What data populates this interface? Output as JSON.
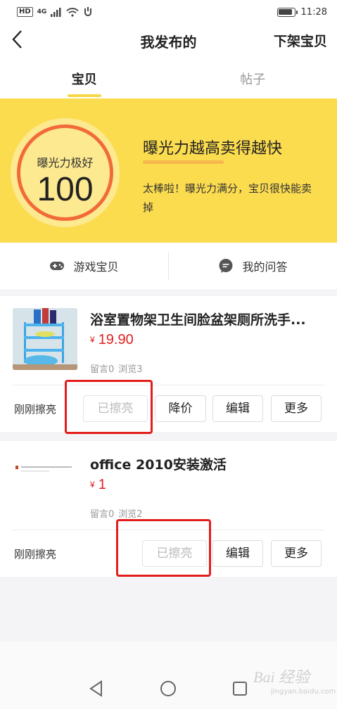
{
  "status_bar": {
    "hd": "HD",
    "network": "4G",
    "time": "11:28"
  },
  "header": {
    "title": "我发布的",
    "action": "下架宝贝"
  },
  "tabs": [
    {
      "label": "宝贝",
      "active": true
    },
    {
      "label": "帖子",
      "active": false
    }
  ],
  "banner": {
    "score_label": "曝光力极好",
    "score_value": "100",
    "headline": "曝光力越高卖得越快",
    "desc": "太棒啦！曝光力满分，宝贝很快能卖掉"
  },
  "quick_links": [
    {
      "label": "游戏宝贝",
      "icon": "gamepad-icon"
    },
    {
      "label": "我的问答",
      "icon": "chat-bubble-icon"
    }
  ],
  "listings": [
    {
      "title": "浴室置物架卫生间脸盆架厕所洗手...",
      "currency": "¥",
      "price": "19.90",
      "comments": "留言0",
      "views": "浏览3",
      "bump_status": "刚刚擦亮",
      "buttons": {
        "bumped": "已擦亮",
        "reduce": "降价",
        "edit": "编辑",
        "more": "更多"
      }
    },
    {
      "title": "office 2010安装激活",
      "currency": "¥",
      "price": "1",
      "comments": "留言0",
      "views": "浏览2",
      "bump_status": "刚刚擦亮",
      "buttons": {
        "bumped": "已擦亮",
        "edit": "编辑",
        "more": "更多"
      }
    }
  ],
  "watermark": {
    "text": "Bai 经验",
    "sub": "jingyan.baidu.com"
  },
  "colors": {
    "brand_yellow": "#fcdc4f",
    "price_red": "#e02020",
    "ring_orange": "#f26a3a",
    "highlight_red": "#e31d1d"
  }
}
